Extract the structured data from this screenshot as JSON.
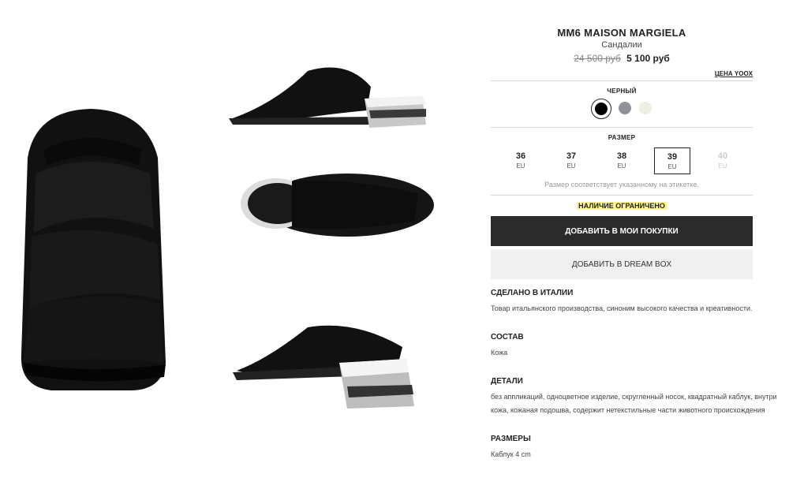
{
  "product": {
    "brand": "MM6 MAISON MARGIELA",
    "category": "Сандалии",
    "old_price": "24 500 руб",
    "new_price": "5 100 руб",
    "price_link": "ЦЕНА YOOX"
  },
  "color": {
    "label": "ЧЕРНЫЙ",
    "swatches": [
      {
        "color": "#000000",
        "selected": true
      },
      {
        "color": "#8e9399",
        "selected": false
      },
      {
        "color": "#eeeee3",
        "selected": false
      }
    ]
  },
  "size": {
    "label": "РАЗМЕР",
    "options": [
      {
        "num": "36",
        "unit": "EU",
        "state": "available"
      },
      {
        "num": "37",
        "unit": "EU",
        "state": "available"
      },
      {
        "num": "38",
        "unit": "EU",
        "state": "available"
      },
      {
        "num": "39",
        "unit": "EU",
        "state": "selected"
      },
      {
        "num": "40",
        "unit": "EU",
        "state": "disabled"
      }
    ],
    "note": "Размер соответствует указанному на этикетке."
  },
  "availability": "НАЛИЧИЕ ОГРАНИЧЕНО",
  "buttons": {
    "add_to_cart": "ДОБАВИТЬ В МОИ ПОКУПКИ",
    "add_to_dreambox": "ДОБАВИТЬ В DREAM BOX"
  },
  "info": {
    "made_in": {
      "title": "СДЕЛАНО В ИТАЛИИ",
      "text": "Товар итальянского производства, синоним высокого качества и креативности."
    },
    "composition": {
      "title": "СОСТАВ",
      "text": "Кожа"
    },
    "details": {
      "title": "ДЕТАЛИ",
      "text": "без аппликаций, одноцветное изделие, скругленный носок, квадратный каблук, внутри кожа, кожаная подошва, содержит нетекстильные части животного происхождения"
    },
    "dimensions": {
      "title": "РАЗМЕРЫ",
      "text": "Каблук 4 cm"
    }
  }
}
